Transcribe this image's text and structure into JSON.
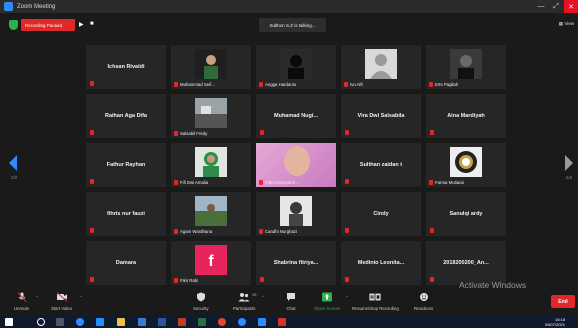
{
  "window": {
    "title": "Zoom Meeting"
  },
  "topbar": {
    "recording_label": "Recording Paused",
    "resume_glyph": "▶",
    "stop_glyph": "■",
    "speaking_text": "Sulthon S.Z is talking...",
    "view_label": "View"
  },
  "participants": [
    {
      "name": "Ichsan Rivaldi",
      "label": "",
      "video": false
    },
    {
      "name": "",
      "label": "Muhammad Seif...",
      "video": true,
      "thumb": "avatar-green"
    },
    {
      "name": "",
      "label": "Angga Hardanto",
      "video": true,
      "thumb": "silhouette"
    },
    {
      "name": "",
      "label": "Ivo Alfi",
      "video": true,
      "thumb": "default-avatar"
    },
    {
      "name": "",
      "label": "Erts Pagilah",
      "video": true,
      "thumb": "dark-photo"
    },
    {
      "name": "Raihan Aga Difa",
      "label": "",
      "video": false
    },
    {
      "name": "",
      "label": "Salsabil Fredy",
      "video": true,
      "thumb": "landscape"
    },
    {
      "name": "Muhamad  Nugi...",
      "label": "",
      "video": false
    },
    {
      "name": "Vira Dwi Salsabila",
      "label": "",
      "video": false
    },
    {
      "name": "Aina Mardiyah",
      "label": "",
      "video": false
    },
    {
      "name": "Fathur Rayhan",
      "label": "",
      "video": false
    },
    {
      "name": "",
      "label": "Fifi Dwi Amalia",
      "video": true,
      "thumb": "hijab-green"
    },
    {
      "name": "",
      "label": "Villa Damayanti ...",
      "video": true,
      "thumb": "pink-face"
    },
    {
      "name": "Sulthan zaidan t",
      "label": "",
      "video": false
    },
    {
      "name": "",
      "label": "Farma Mutiarai",
      "video": true,
      "thumb": "badge"
    },
    {
      "name": "fihris nur fauzi",
      "label": "",
      "video": false
    },
    {
      "name": "",
      "label": "Agam Wardhana",
      "video": true,
      "thumb": "outdoor"
    },
    {
      "name": "",
      "label": "Candhi Nurghazi",
      "video": true,
      "thumb": "person"
    },
    {
      "name": "Cindy",
      "label": "",
      "video": false
    },
    {
      "name": "Sanulqi ardy",
      "label": "",
      "video": false
    },
    {
      "name": "Damara",
      "label": "",
      "video": false
    },
    {
      "name": "",
      "label": "Fikri Rabi",
      "video": true,
      "thumb": "facebook"
    },
    {
      "name": "Shabrina  fitriya...",
      "label": "",
      "video": false
    },
    {
      "name": "Medinio  Leonita...",
      "label": "",
      "video": false
    },
    {
      "name": "2018200200_An...",
      "label": "",
      "video": false
    }
  ],
  "pagination": {
    "left": "2/2",
    "right": "2/2"
  },
  "toolbar": {
    "items": [
      {
        "key": "unmute",
        "label": "Unmute",
        "icon": "mic-muted-icon"
      },
      {
        "key": "start_video",
        "label": "Start Video",
        "icon": "video-off-icon"
      },
      {
        "key": "security",
        "label": "Security",
        "icon": "shield-icon"
      },
      {
        "key": "participants",
        "label": "Participants",
        "icon": "participants-icon",
        "count": "38"
      },
      {
        "key": "chat",
        "label": "Chat",
        "icon": "chat-icon"
      },
      {
        "key": "share_screen",
        "label": "Share Screen",
        "icon": "share-screen-icon"
      },
      {
        "key": "recording",
        "label": "Resume/Stop Recording",
        "icon": "recording-icon"
      },
      {
        "key": "reactions",
        "label": "Reactions",
        "icon": "reactions-icon"
      }
    ],
    "end_label": "End"
  },
  "watermark": {
    "line1": "Activate Windows",
    "line2": "Go to Settings to activate Windows."
  },
  "taskbar": {
    "time": "15:18",
    "date": "09/07/2021"
  },
  "colors": {
    "accent": "#2d8cff",
    "record": "#e02828",
    "share": "#2bb24c"
  }
}
